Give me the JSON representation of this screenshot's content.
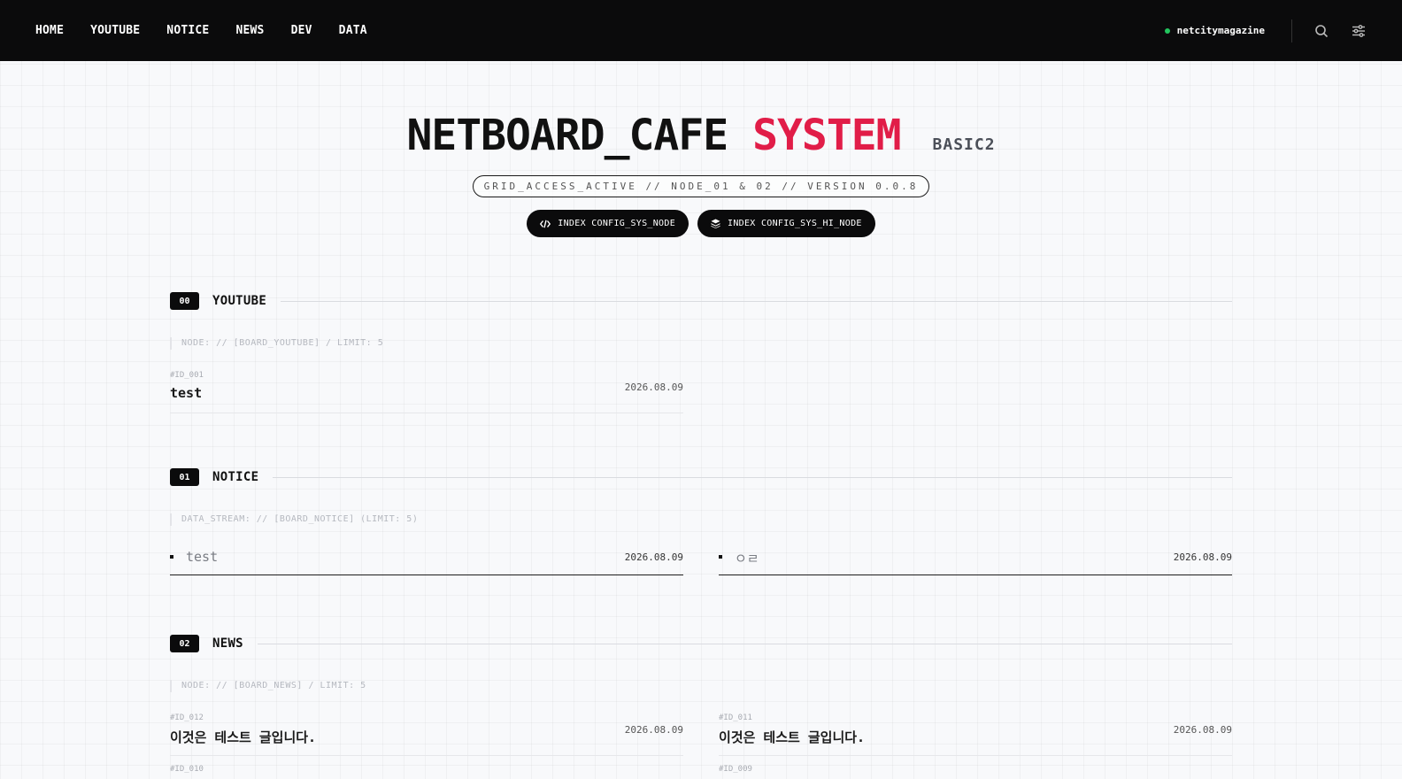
{
  "nav": {
    "links": [
      "HOME",
      "YOUTUBE",
      "NOTICE",
      "NEWS",
      "DEV",
      "DATA"
    ],
    "username": "netcitymagazine",
    "status_color": "#22c55e",
    "icons": [
      "search-icon",
      "settings-sliders-icon"
    ]
  },
  "hero": {
    "title_main": "NETBOARD_CAFE",
    "title_accent": "SYSTEM",
    "subtitle": "BASIC2",
    "accent_color": "#e11d48",
    "pill": "GRID_ACCESS_ACTIVE // NODE_01 & 02 // VERSION 0.0.8",
    "buttons": [
      {
        "label": "INDEX CONFIG_SYS_NODE",
        "icon": "code-icon"
      },
      {
        "label": "INDEX CONFIG_SYS_HI_NODE",
        "icon": "layers-icon"
      }
    ]
  },
  "sections": {
    "youtube": {
      "num": "00",
      "title": "YOUTUBE",
      "meta": "NODE: // [BOARD_YOUTUBE] / LIMIT: 5",
      "posts": [
        {
          "id": "#ID_001",
          "title": "test",
          "date": "2026.08.09"
        }
      ]
    },
    "notice": {
      "num": "01",
      "title": "NOTICE",
      "meta": "DATA_STREAM: // [BOARD_NOTICE] (LIMIT: 5)",
      "posts": [
        {
          "title": "test",
          "date": "2026.08.09"
        },
        {
          "title": "ㅇㄹ",
          "date": "2026.08.09"
        }
      ]
    },
    "news": {
      "num": "02",
      "title": "NEWS",
      "meta": "NODE: // [BOARD_NEWS] / LIMIT: 5",
      "posts": [
        {
          "id": "#ID_012",
          "title": "이것은 테스트 글입니다.",
          "date": "2026.08.09"
        },
        {
          "id": "#ID_011",
          "title": "이것은 테스트 글입니다.",
          "date": "2026.08.09"
        },
        {
          "id": "#ID_010",
          "title": "",
          "date": ""
        },
        {
          "id": "#ID_009",
          "title": "",
          "date": ""
        }
      ]
    }
  }
}
